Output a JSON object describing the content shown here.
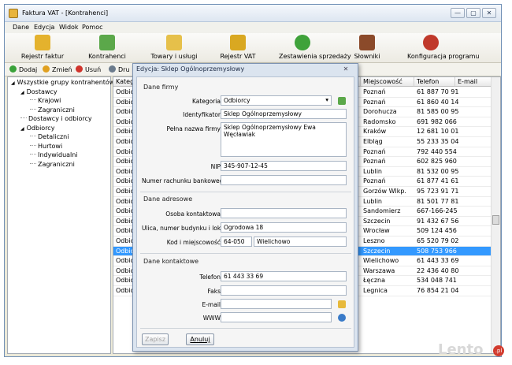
{
  "window": {
    "title": "Faktura VAT - [Kontrahenci]",
    "controls": [
      "—",
      "▢",
      "✕"
    ]
  },
  "menu": [
    "Dane",
    "Edycja",
    "Widok",
    "Pomoc"
  ],
  "ribbon": [
    {
      "label": "Rejestr faktur",
      "color": "#e4b22d"
    },
    {
      "label": "Kontrahenci",
      "color": "#5ba84a"
    },
    {
      "label": "Towary i usługi",
      "color": "#e6c04a"
    },
    {
      "label": "Rejestr VAT",
      "color": "#d9a821"
    },
    {
      "label": "Zestawienia sprzedaży",
      "color": "#3fa23a"
    },
    {
      "label": "Słowniki",
      "color": "#8b4a2a"
    },
    {
      "label": "Konfiguracja programu",
      "color": "#c0392b"
    }
  ],
  "toolbar": [
    {
      "label": "Dodaj",
      "color": "#3aa23a"
    },
    {
      "label": "Zmień",
      "color": "#e0a020"
    },
    {
      "label": "Usuń",
      "color": "#d0342c"
    },
    {
      "label": "Dru",
      "color": "#6b7b8c"
    }
  ],
  "tree": [
    {
      "label": "Wszystkie grupy kontrahentów",
      "level": 0,
      "toggle": "◢"
    },
    {
      "label": "Dostawcy",
      "level": 1,
      "toggle": "◢"
    },
    {
      "label": "Krajowi",
      "level": 2
    },
    {
      "label": "Zagraniczni",
      "level": 2
    },
    {
      "label": "Dostawcy i odbiorcy",
      "level": 1
    },
    {
      "label": "Odbiorcy",
      "level": 1,
      "toggle": "◢"
    },
    {
      "label": "Detaliczni",
      "level": 2
    },
    {
      "label": "Hurtowi",
      "level": 2
    },
    {
      "label": "Indywidualni",
      "level": 2
    },
    {
      "label": "Zagraniczni",
      "level": 2
    }
  ],
  "grid": {
    "headers": {
      "kategoria": "Katego",
      "miejscowosc": "Miejscowość",
      "telefon": "Telefon",
      "email": "E-mail"
    },
    "selected_index": 16,
    "rows": [
      {
        "kat": "Odbio",
        "miasto": "Poznań",
        "tel": "61 887 70 91"
      },
      {
        "kat": "Odbio",
        "miasto": "Poznań",
        "tel": "61 860 40 14"
      },
      {
        "kat": "Odbio",
        "miasto": "Dorohucza",
        "tel": "81 585 00 95"
      },
      {
        "kat": "Odbio",
        "miasto": "Radomsko",
        "tel": "691 982 066"
      },
      {
        "kat": "Odbio",
        "miasto": "Kraków",
        "tel": "12 681 10 01"
      },
      {
        "kat": "Odbio",
        "miasto": "Elbląg",
        "tel": "55 233 35 04"
      },
      {
        "kat": "Odbio",
        "miasto": "Poznań",
        "tel": "792 440 554"
      },
      {
        "kat": "Odbio",
        "miasto": "Poznań",
        "tel": "602 825 960"
      },
      {
        "kat": "Odbio",
        "miasto": "Lublin",
        "tel": " 81 532 00 95"
      },
      {
        "kat": "Odbio",
        "miasto": "Poznań",
        "tel": "61 877 41 61"
      },
      {
        "kat": "Odbio",
        "miasto": "Gorzów Wlkp.",
        "tel": "95 723 91 71"
      },
      {
        "kat": "Odbio",
        "miasto": "Lublin",
        "tel": "81 501 77 81"
      },
      {
        "kat": "Odbio",
        "miasto": "Sandomierz",
        "tel": "667-166-245"
      },
      {
        "kat": "Odbio",
        "miasto": "Szczecin",
        "tel": "91 432 67 56"
      },
      {
        "kat": "Odbio",
        "miasto": "Wrocław",
        "tel": "509 124 456"
      },
      {
        "kat": "Odbio",
        "miasto": "Leszno",
        "tel": "65 520 79 02"
      },
      {
        "kat": "Odbio",
        "miasto": "Szczecin",
        "tel": "508 753 966"
      },
      {
        "kat": "Odbio",
        "miasto": "Wielichowo",
        "tel": "61 443 33 69"
      },
      {
        "kat": "Odbio",
        "miasto": "Warszawa",
        "tel": "22 436 40 80"
      },
      {
        "kat": "Odbio",
        "miasto": "Łęczna",
        "tel": "534 048 741"
      },
      {
        "kat": "Odbio",
        "miasto": "Legnica",
        "tel": "76 854 21 04"
      }
    ]
  },
  "dialog": {
    "title": "Edycja: Sklep Ogólnoprzemysłowy",
    "close": "✕",
    "sections": {
      "firma": "Dane firmy",
      "adres": "Dane adresowe",
      "kontakt": "Dane kontaktowe"
    },
    "labels": {
      "kategoria": "Kategoria",
      "identyfikator": "Identyfikator",
      "pelna_nazwa": "Pełna nazwa firmy",
      "nip": "NIP",
      "konto": "Numer rachunku bankowego",
      "osoba": "Osoba kontaktowa",
      "ulica": "Ulica, numer budynku i lokalu",
      "kod": "Kod i miejscowość",
      "telefon": "Telefon",
      "faks": "Faks",
      "email": "E-mail",
      "www": "WWW"
    },
    "values": {
      "kategoria": "Odbiorcy",
      "identyfikator": "Sklep Ogólnoprzemysłowy",
      "pelna_nazwa": "Sklep Ogólnoprzemysłowy Ewa Węcławiak",
      "nip": "345-907-12-45",
      "konto": "",
      "osoba": "",
      "ulica": "Ogrodowa 18",
      "kod": "64-050",
      "miejscowosc": "Wielichowo",
      "telefon": "61 443 33 69",
      "faks": "",
      "email": "",
      "www": ""
    },
    "buttons": {
      "save": "Zapisz",
      "cancel": "Anuluj"
    }
  },
  "watermark": {
    "text": "Lento",
    "suffix": ".pl"
  }
}
